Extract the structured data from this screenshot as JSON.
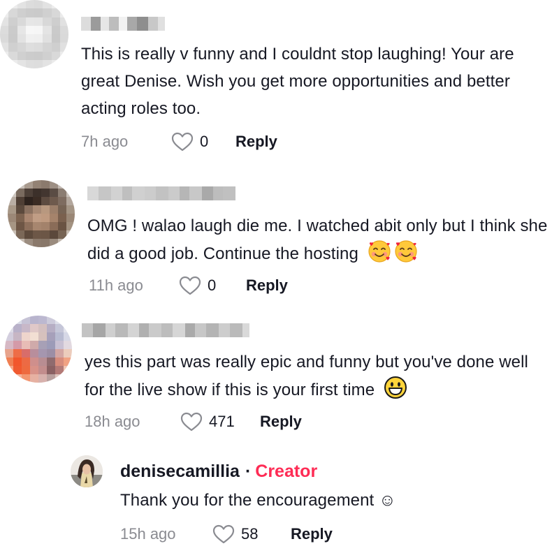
{
  "comments": [
    {
      "text": "This is really v funny and I couldnt stop laughing! Your are great Denise. Wish you get more opportunities and better acting roles too.",
      "time": "7h ago",
      "likes": "0",
      "reply_label": "Reply"
    },
    {
      "text": "OMG ! walao laugh die me. I watched abit only but I think she did a good job. Continue the hosting",
      "time": "11h ago",
      "likes": "0",
      "reply_label": "Reply"
    },
    {
      "text": "yes this part was really epic and funny but you've done well for the live show if this is your first time",
      "time": "18h ago",
      "likes": "471",
      "reply_label": "Reply"
    }
  ],
  "reply": {
    "username": "denisecamillia",
    "separator": "·",
    "badge": "Creator",
    "text": "Thank you for the encouragement ☺",
    "time": "15h ago",
    "likes": "58",
    "reply_label": "Reply"
  },
  "colors": {
    "text": "#161823",
    "muted": "#8a8b91",
    "creator_badge": "#fe2c55"
  },
  "icons": {
    "like": "heart-outline-icon",
    "smile_hearts": "smiling-face-with-hearts-emoji",
    "grin": "grinning-face-emoji"
  }
}
